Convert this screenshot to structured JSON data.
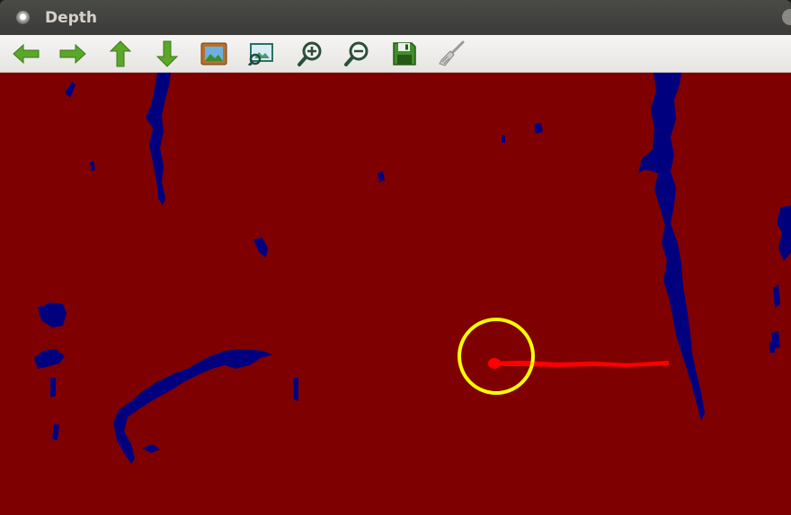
{
  "window": {
    "title": "Depth"
  },
  "toolbar": {
    "buttons": [
      {
        "name": "pan-left",
        "icon": "arrow-left-icon"
      },
      {
        "name": "pan-right",
        "icon": "arrow-right-icon"
      },
      {
        "name": "pan-up",
        "icon": "arrow-up-icon"
      },
      {
        "name": "pan-down",
        "icon": "arrow-down-icon"
      },
      {
        "name": "zoom-fit",
        "icon": "image-icon"
      },
      {
        "name": "zoom-region",
        "icon": "zoom-region-icon"
      },
      {
        "name": "zoom-in",
        "icon": "zoom-in-icon"
      },
      {
        "name": "zoom-out",
        "icon": "zoom-out-icon"
      },
      {
        "name": "save",
        "icon": "save-icon"
      },
      {
        "name": "properties",
        "icon": "brush-icon"
      }
    ]
  },
  "colors": {
    "background_far": "#7f0000",
    "near_obstacles": "#00007f",
    "marker_circle": "#ffff00",
    "direction_line": "#ff0000",
    "arrow_green": "#5aa72a"
  }
}
